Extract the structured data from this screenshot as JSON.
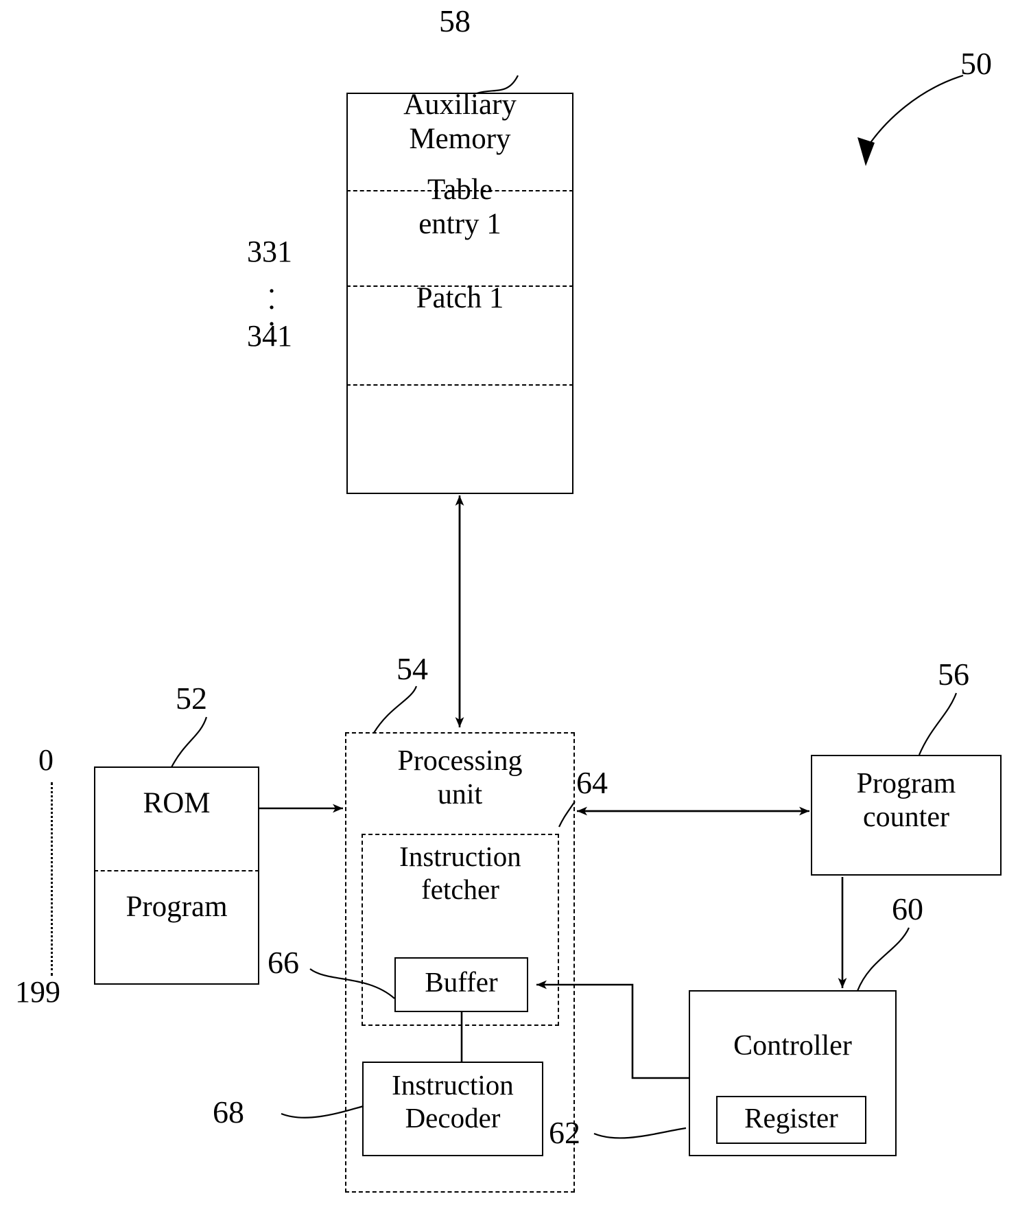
{
  "figure": {
    "ref_main": "50"
  },
  "aux_memory": {
    "ref": "58",
    "title": "Auxiliary\nMemory",
    "rows": [
      {
        "label": "Table\nentry 1"
      },
      {
        "label": "Patch 1"
      },
      {
        "label": ""
      }
    ],
    "addr_top": "331",
    "addr_dots": "⋮",
    "addr_bottom": "341"
  },
  "rom": {
    "ref": "52",
    "title": "ROM",
    "section": "Program",
    "addr_start": "0",
    "addr_end": "199"
  },
  "processing_unit": {
    "ref": "54",
    "title": "Processing\nunit",
    "instruction_fetcher": {
      "ref": "64",
      "title": "Instruction\nfetcher"
    },
    "buffer": {
      "ref": "66",
      "title": "Buffer"
    },
    "instruction_decoder": {
      "ref": "68",
      "title": "Instruction\nDecoder"
    }
  },
  "program_counter": {
    "ref": "56",
    "title": "Program\ncounter"
  },
  "controller": {
    "ref": "60",
    "title": "Controller",
    "register": {
      "ref": "62",
      "title": "Register"
    }
  },
  "colors": {
    "stroke": "#000000",
    "background": "#ffffff"
  }
}
